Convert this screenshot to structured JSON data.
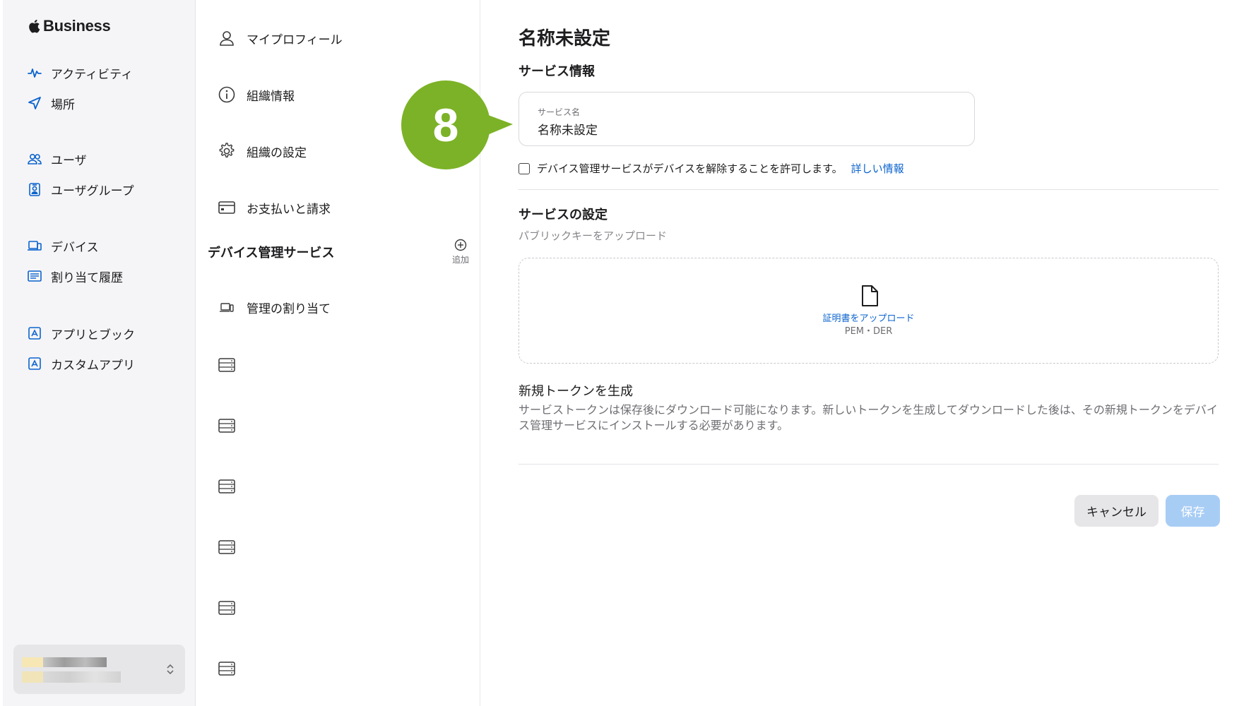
{
  "brand": {
    "name": "Business"
  },
  "sidebar": {
    "items": [
      {
        "label": "アクティビティ",
        "icon": "activity-icon"
      },
      {
        "label": "場所",
        "icon": "location-arrow-icon"
      },
      {
        "label": "ユーザ",
        "icon": "users-icon"
      },
      {
        "label": "ユーザグループ",
        "icon": "user-group-icon"
      },
      {
        "label": "デバイス",
        "icon": "devices-icon"
      },
      {
        "label": "割り当て履歴",
        "icon": "assignment-history-icon"
      },
      {
        "label": "アプリとブック",
        "icon": "apps-books-icon"
      },
      {
        "label": "カスタムアプリ",
        "icon": "custom-apps-icon"
      }
    ]
  },
  "settings": {
    "items": [
      {
        "label": "マイプロフィール",
        "icon": "person-icon"
      },
      {
        "label": "組織情報",
        "icon": "info-icon"
      },
      {
        "label": "組織の設定",
        "icon": "gear-icon"
      },
      {
        "label": "お支払いと請求",
        "icon": "credit-card-icon"
      }
    ],
    "section_title": "デバイス管理サービス",
    "add_label": "追加",
    "assignment_label": "管理の割り当て"
  },
  "callout": {
    "number": "8",
    "color": "#7cb227"
  },
  "main": {
    "title": "名称未設定",
    "service_info_heading": "サービス情報",
    "service_name_label": "サービス名",
    "service_name_value": "名称未設定",
    "release_checkbox_label": "デバイス管理サービスがデバイスを解除することを許可します。",
    "learn_more": "詳しい情報",
    "service_settings_heading": "サービスの設定",
    "upload_public_key": "パブリックキーをアップロード",
    "upload_certificate": "証明書をアップロード",
    "formats": "PEM・DER",
    "new_token_heading": "新規トークンを生成",
    "token_description": "サービストークンは保存後にダウンロード可能になります。新しいトークンを生成してダウンロードした後は、その新規トークンをデバイス管理サービスにインストールする必要があります。",
    "cancel": "キャンセル",
    "save": "保存"
  },
  "colors": {
    "accent": "#0b63ce",
    "save_disabled": "#a8cdf5"
  }
}
